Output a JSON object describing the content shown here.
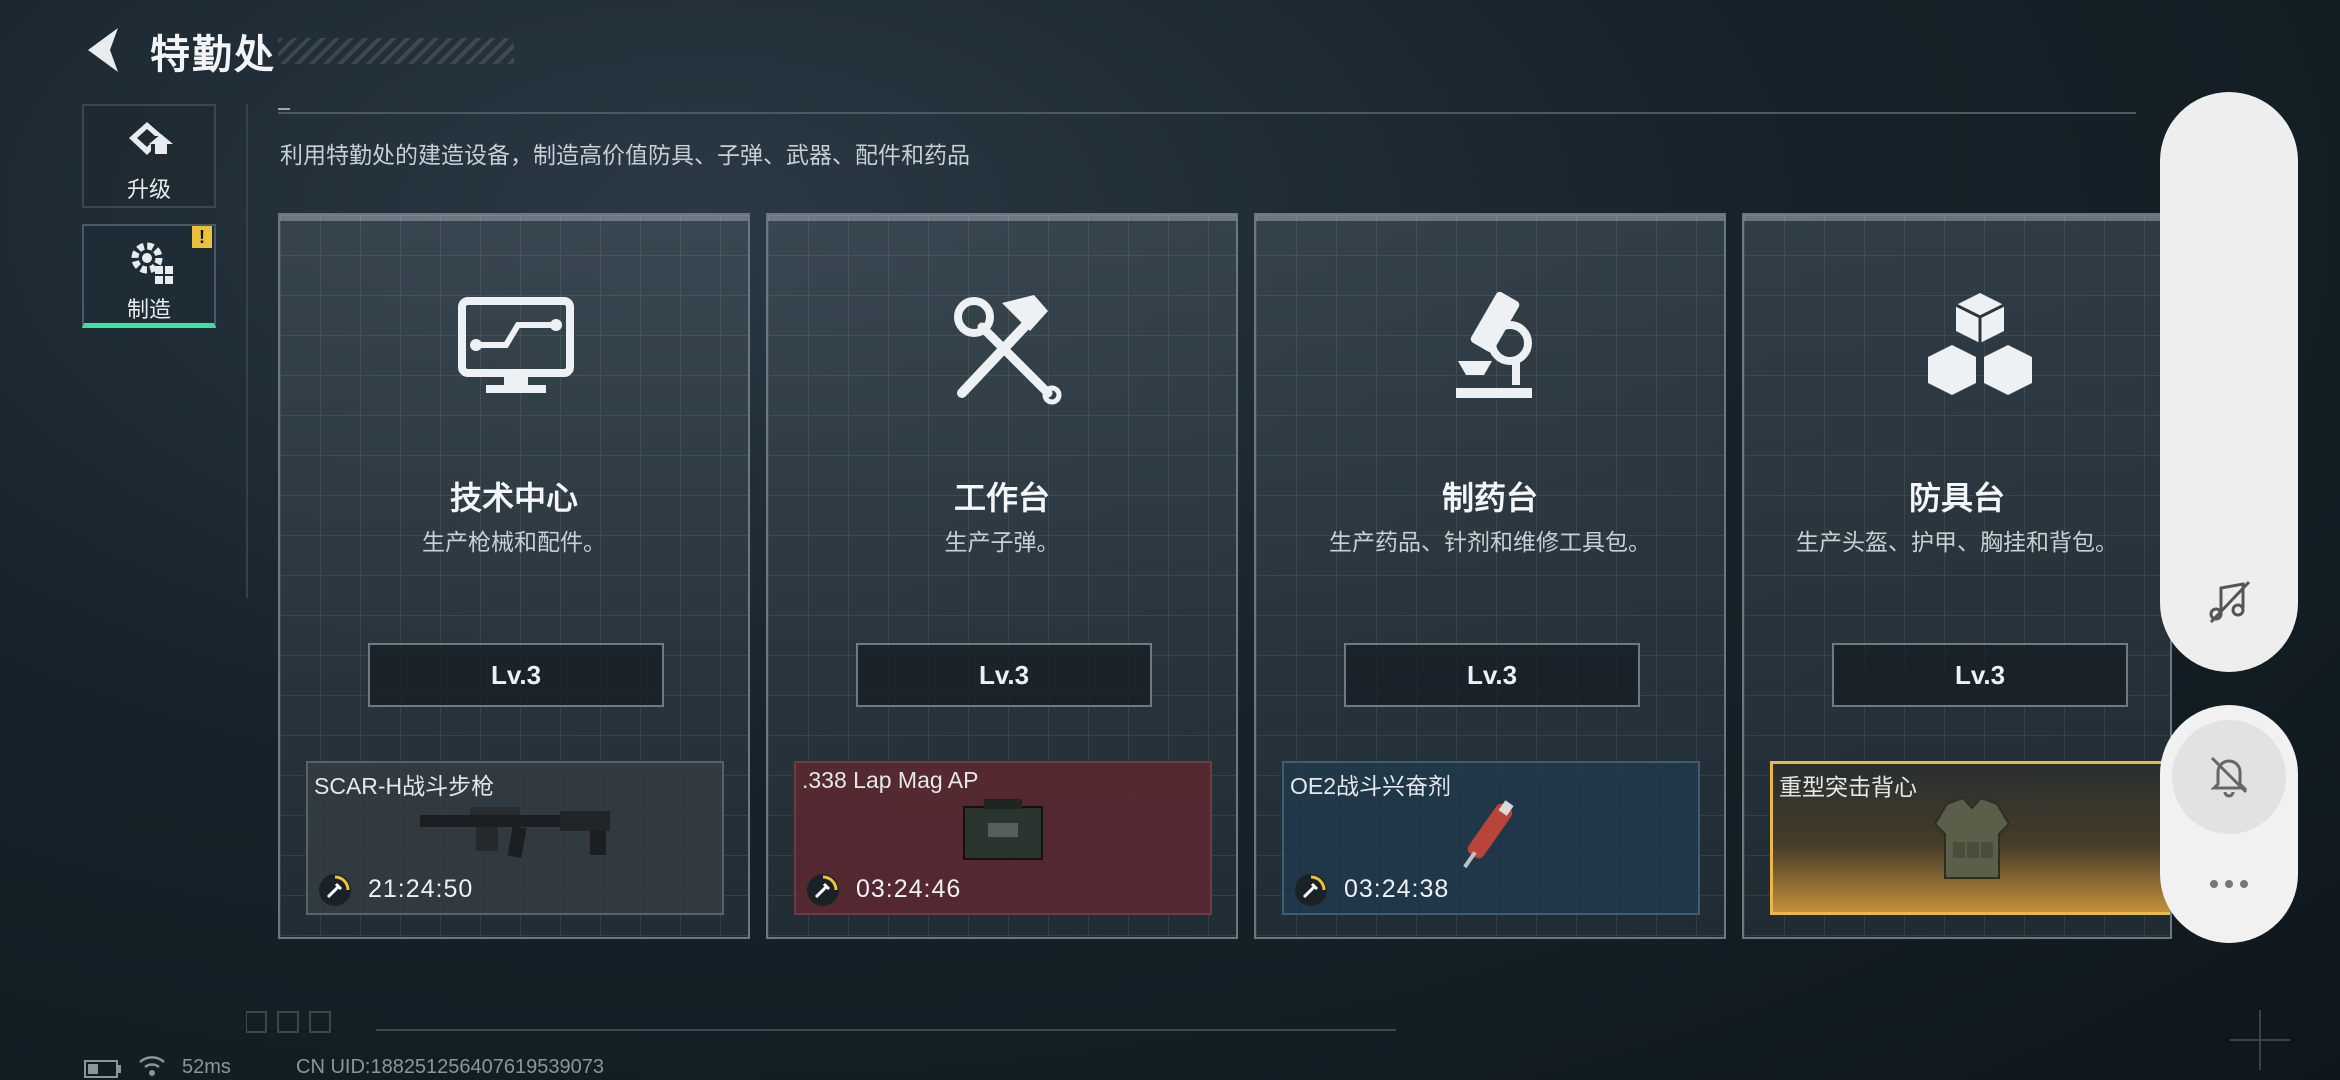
{
  "header": {
    "title": "特勤处",
    "subtitle": "利用特勤处的建造设备，制造高价值防具、子弹、武器、配件和药品"
  },
  "sidebar": {
    "items": [
      {
        "label": "升级",
        "icon": "upgrade-icon",
        "active": false
      },
      {
        "label": "制造",
        "icon": "crafting-gear-icon",
        "active": true,
        "badge": "!"
      }
    ]
  },
  "stations": [
    {
      "name": "技术中心",
      "desc": "生产枪械和配件。",
      "icon": "computer-terminal-icon",
      "level": "Lv.3",
      "product": {
        "name": "SCAR-H战斗步枪",
        "timer": "21:24:50",
        "style": "grey"
      }
    },
    {
      "name": "工作台",
      "desc": "生产子弹。",
      "icon": "hammer-wrench-icon",
      "level": "Lv.3",
      "product": {
        "name": ".338 Lap Mag AP",
        "timer": "03:24:46",
        "style": "red"
      }
    },
    {
      "name": "制药台",
      "desc": "生产药品、针剂和维修工具包。",
      "icon": "microscope-icon",
      "level": "Lv.3",
      "product": {
        "name": "OE2战斗兴奋剂",
        "timer": "03:24:38",
        "style": "blue"
      }
    },
    {
      "name": "防具台",
      "desc": "生产头盔、护甲、胸挂和背包。",
      "icon": "boxes-icon",
      "level": "Lv.3",
      "product": {
        "name": "重型突击背心",
        "timer": "",
        "style": "gold"
      }
    }
  ],
  "status_bar": {
    "ping": "52ms",
    "uid": "CN UID:1882512564076195390​73"
  },
  "colors": {
    "accent_green": "#3fe0a0",
    "warning_yellow": "#e9c23a",
    "gold_border": "#e9b84b"
  }
}
